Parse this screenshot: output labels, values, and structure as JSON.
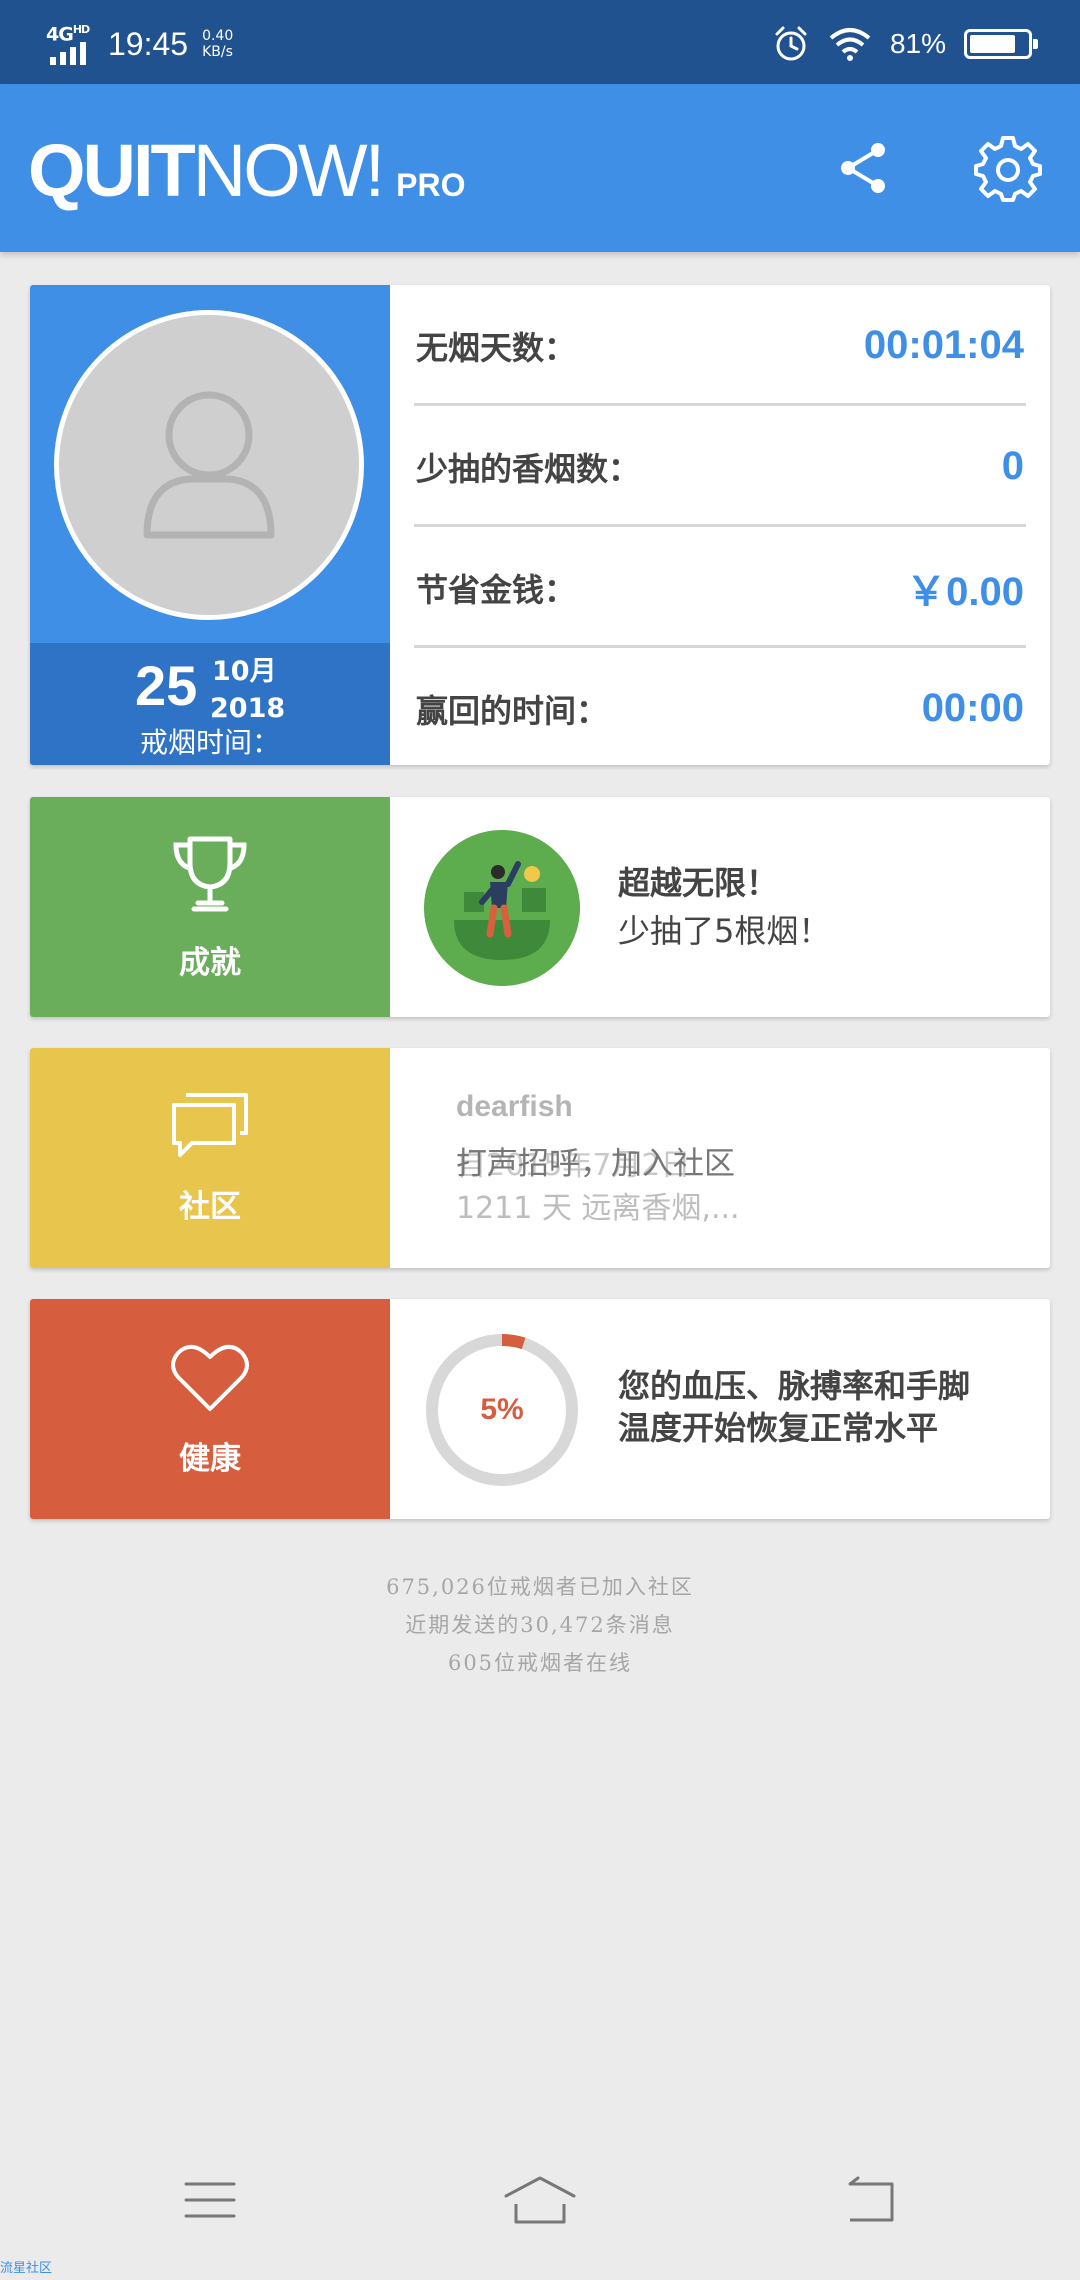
{
  "status_bar": {
    "network": "4G",
    "network_sup": "HD",
    "time": "19:45",
    "speed_value": "0.40",
    "speed_unit": "KB/s",
    "battery": "81%",
    "battery_level": 0.81,
    "icons": [
      "signal-icon",
      "alarm-icon",
      "wifi-icon",
      "battery-icon"
    ]
  },
  "app_bar": {
    "logo_quit": "QUIT",
    "logo_now": "NOW!",
    "logo_pro": "PRO",
    "color": "#3e8fe5",
    "actions": [
      "share-icon",
      "settings-icon"
    ]
  },
  "profile": {
    "quit_date": {
      "day": "25",
      "month": "10月",
      "year": "2018",
      "label": "戒烟时间："
    },
    "stats": [
      {
        "label": "无烟天数：",
        "value": "00:01:04"
      },
      {
        "label": "少抽的香烟数：",
        "value": "0"
      },
      {
        "label": "节省金钱：",
        "value": "￥0.00"
      },
      {
        "label": "赢回的时间：",
        "value": "00:00"
      }
    ]
  },
  "achievements": {
    "label": "成就",
    "color": "#6aad5a",
    "title": "超越无限！",
    "subtitle": "少抽了5根烟！"
  },
  "community": {
    "label": "社区",
    "color": "#e8c64d",
    "username": "dearfish",
    "ghost_text": "自2015年7月2日",
    "message": "打声招呼，加入社区",
    "snippet": "1211 天 远离香烟,..."
  },
  "health": {
    "label": "健康",
    "color": "#d65d3e",
    "progress": 0.05,
    "progress_label": "5%",
    "text_line1": "您的血压、脉搏率和手脚",
    "text_line2": "温度开始恢复正常水平"
  },
  "community_stats": [
    "675,026位戒烟者已加入社区",
    "近期发送的30,472条消息",
    "605位戒烟者在线"
  ],
  "nav_bar": [
    "menu-icon",
    "home-icon",
    "back-icon"
  ],
  "watermark": "流星社区"
}
